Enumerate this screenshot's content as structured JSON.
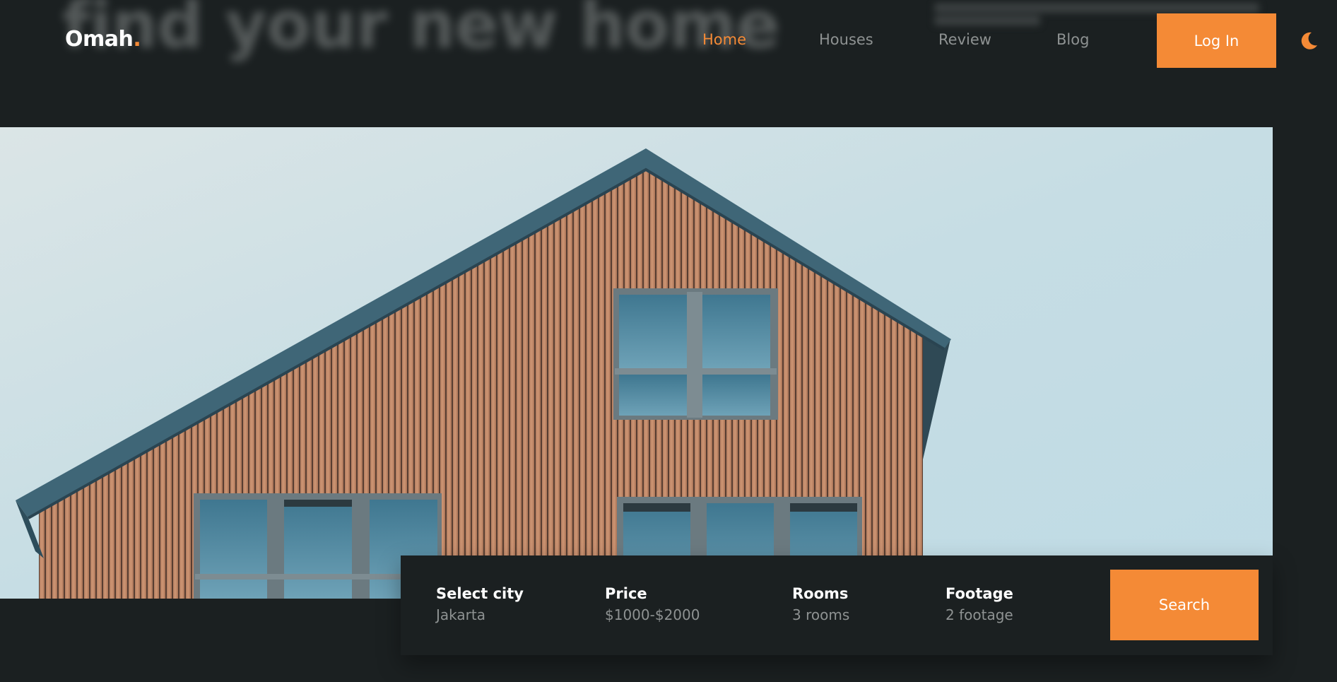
{
  "background": {
    "heading": "find your new home"
  },
  "brand": {
    "name": "Omah",
    "dot": "."
  },
  "nav": {
    "items": [
      {
        "label": "Home",
        "active": true
      },
      {
        "label": "Houses",
        "active": false
      },
      {
        "label": "Review",
        "active": false
      },
      {
        "label": "Blog",
        "active": false
      }
    ],
    "login_label": "Log In",
    "theme_icon": "moon-icon"
  },
  "search": {
    "fields": [
      {
        "label": "Select city",
        "value": "Jakarta"
      },
      {
        "label": "Price",
        "value": "$1000-$2000"
      },
      {
        "label": "Rooms",
        "value": "3 rooms"
      },
      {
        "label": "Footage",
        "value": "2 footage"
      }
    ],
    "button_label": "Search"
  },
  "colors": {
    "background": "#1b2021",
    "accent": "#f48a36",
    "muted_text": "#8e9292",
    "text": "#ffffff"
  }
}
